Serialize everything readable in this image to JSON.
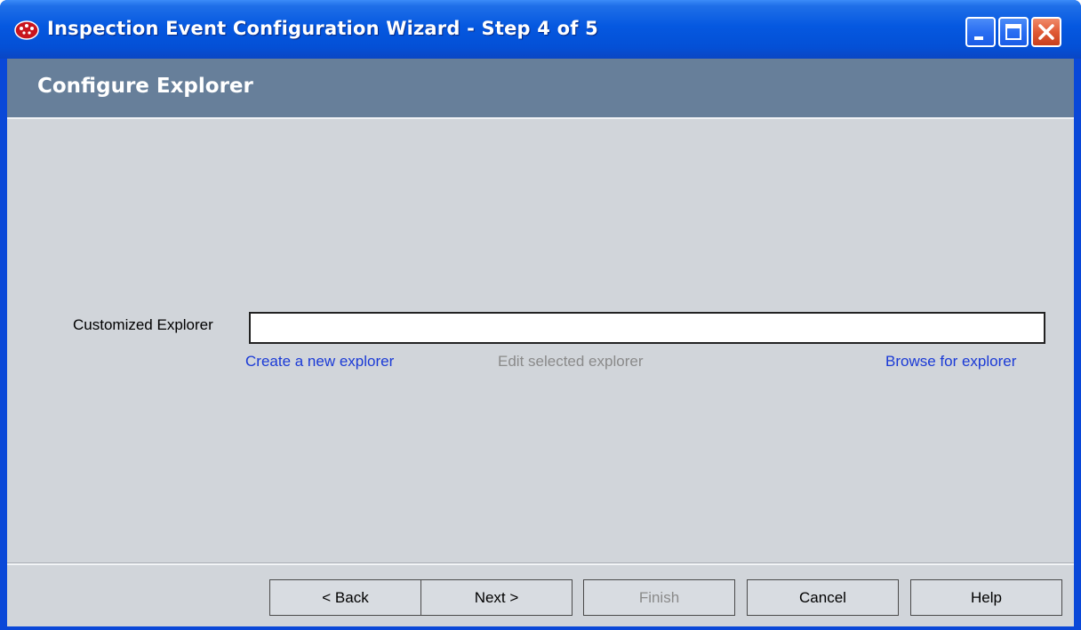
{
  "window": {
    "title": "Inspection Event Configuration Wizard - Step 4 of 5",
    "app_icon": "red-gear-icon",
    "controls": {
      "minimize": "minimize-icon",
      "maximize": "maximize-icon",
      "close": "close-icon"
    }
  },
  "header": {
    "title": "Configure Explorer"
  },
  "form": {
    "label": "Customized Explorer",
    "value": "",
    "placeholder": ""
  },
  "links": {
    "create": "Create a new explorer",
    "edit": "Edit selected explorer",
    "browse": "Browse for explorer"
  },
  "footer": {
    "back": "< Back",
    "next": "Next >",
    "finish": "Finish",
    "cancel": "Cancel",
    "help": "Help"
  },
  "colors": {
    "title_bar": "#0558e0",
    "header_band": "#677f9a",
    "client_bg": "#d1d5da",
    "link_active": "#1a3ad6",
    "link_disabled": "#8a8a8a",
    "close_button": "#e05a36"
  }
}
